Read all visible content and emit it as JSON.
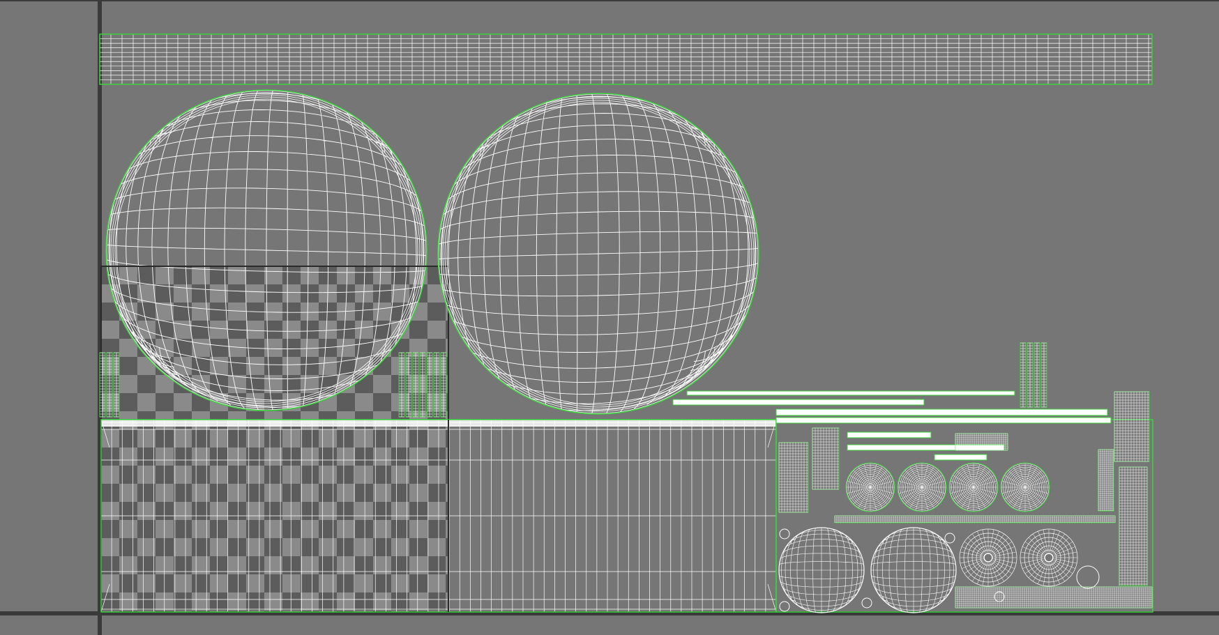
{
  "editor": {
    "name": "uv-texture-editor",
    "background_color": "#767676",
    "grid_axis_color": "#3a3a3a",
    "wireframe_color": "#ffffff",
    "border_color": "#3dd23d",
    "checker_dark": "#5c5c5c",
    "checker_light": "#8a8a8a"
  },
  "shells": {
    "top_strip_rows": 11,
    "sphere_a_rings": 22,
    "sphere_b_rings": 22,
    "grid_columns": 64,
    "small_discs": 4,
    "medium_spheres": 2,
    "medium_discs": 2
  }
}
